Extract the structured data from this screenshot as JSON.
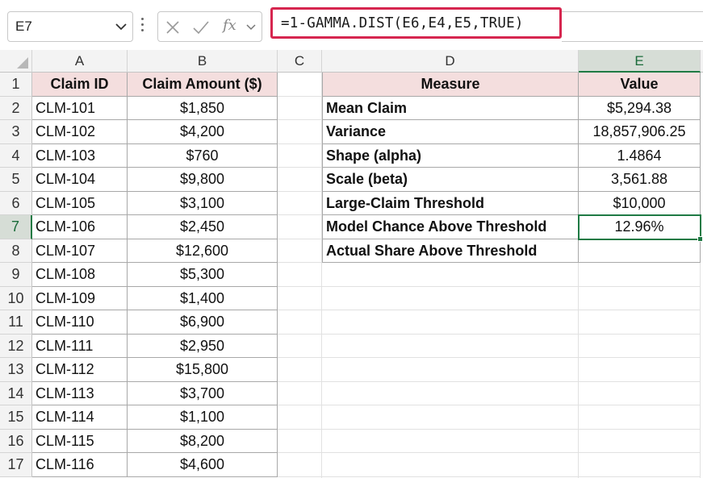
{
  "formula_bar": {
    "name_box": "E7",
    "fx_label": "fx",
    "formula": "=1-GAMMA.DIST(E6,E4,E5,TRUE)"
  },
  "columns": [
    "A",
    "B",
    "C",
    "D",
    "E"
  ],
  "rows": [
    "1",
    "2",
    "3",
    "4",
    "5",
    "6",
    "7",
    "8",
    "9",
    "10",
    "11",
    "12",
    "13",
    "14",
    "15",
    "16",
    "17"
  ],
  "claims_table": {
    "headers": [
      "Claim ID",
      "Claim Amount ($)"
    ],
    "rows": [
      [
        "CLM-101",
        "$1,850"
      ],
      [
        "CLM-102",
        "$4,200"
      ],
      [
        "CLM-103",
        "$760"
      ],
      [
        "CLM-104",
        "$9,800"
      ],
      [
        "CLM-105",
        "$3,100"
      ],
      [
        "CLM-106",
        "$2,450"
      ],
      [
        "CLM-107",
        "$12,600"
      ],
      [
        "CLM-108",
        "$5,300"
      ],
      [
        "CLM-109",
        "$1,400"
      ],
      [
        "CLM-110",
        "$6,900"
      ],
      [
        "CLM-111",
        "$2,950"
      ],
      [
        "CLM-112",
        "$15,800"
      ],
      [
        "CLM-113",
        "$3,700"
      ],
      [
        "CLM-114",
        "$1,100"
      ],
      [
        "CLM-115",
        "$8,200"
      ],
      [
        "CLM-116",
        "$4,600"
      ]
    ]
  },
  "measures_table": {
    "headers": [
      "Measure",
      "Value"
    ],
    "rows": [
      [
        "Mean Claim",
        "$5,294.38"
      ],
      [
        "Variance",
        "18,857,906.25"
      ],
      [
        "Shape (alpha)",
        "1.4864"
      ],
      [
        "Scale (beta)",
        "3,561.88"
      ],
      [
        "Large-Claim Threshold",
        "$10,000"
      ],
      [
        "Model Chance Above Threshold",
        "12.96%"
      ],
      [
        "Actual Share Above Threshold",
        ""
      ]
    ]
  },
  "selection": {
    "active_cell": "E7",
    "accent_color": "#1f7a44",
    "formula_highlight_color": "#d6264f"
  }
}
